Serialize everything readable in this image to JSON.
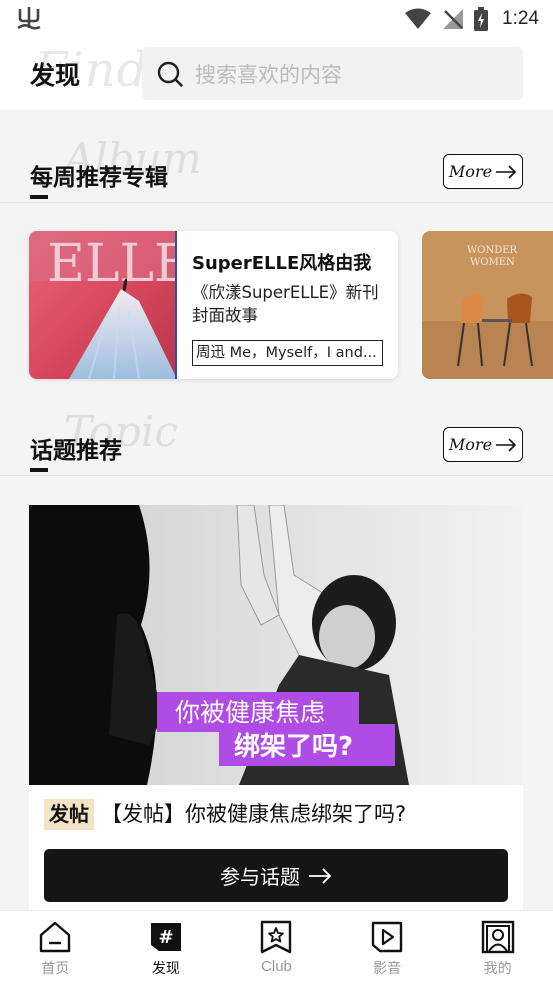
{
  "status_bar": {
    "time": "1:24"
  },
  "header": {
    "title": "发现",
    "watermark": "Find",
    "search_placeholder": "搜索喜欢的内容"
  },
  "albums_section": {
    "title": "每周推荐专辑",
    "watermark": "Album",
    "more_label": "More",
    "items": [
      {
        "title": "SuperELLE风格由我",
        "description": "《欣漾SuperELLE》新刊封面故事",
        "tag": "周迅 Me，Myself，I and..."
      }
    ]
  },
  "topics_section": {
    "title": "话题推荐",
    "watermark": "Topic",
    "more_label": "More",
    "card": {
      "image_caption_line1": "你被健康焦虑",
      "image_caption_line2": "绑架了吗?",
      "badge": "发帖",
      "title": "【发帖】你被健康焦虑绑架了吗?",
      "join_label": "参与话题"
    }
  },
  "bottom_nav": {
    "items": [
      {
        "label": "首页",
        "icon": "home-icon",
        "active": false
      },
      {
        "label": "发现",
        "icon": "hashtag-icon",
        "active": true
      },
      {
        "label": "Club",
        "icon": "star-bookmark-icon",
        "active": false
      },
      {
        "label": "影音",
        "icon": "video-book-icon",
        "active": false
      },
      {
        "label": "我的",
        "icon": "profile-icon",
        "active": false
      }
    ]
  },
  "colors": {
    "accent": "#111111",
    "inactive": "#999999",
    "badge_bg": "#f3e3c7",
    "caption_purple": "#b04ce6"
  }
}
